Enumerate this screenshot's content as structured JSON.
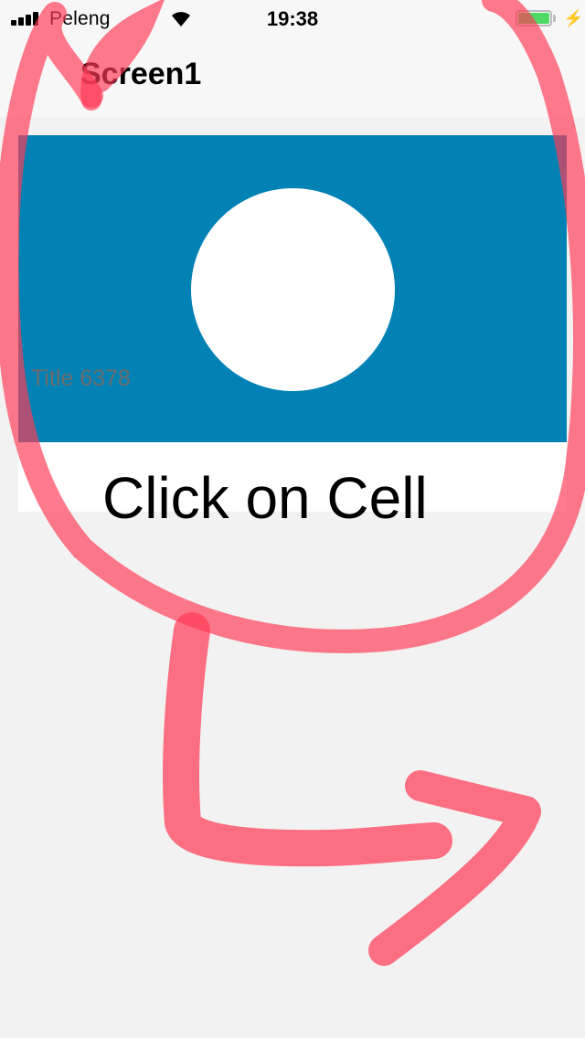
{
  "status_bar": {
    "carrier": "Peleng",
    "time": "19:38",
    "signal_icon": "signal-icon",
    "wifi_icon": "wifi-icon",
    "battery_icon": "battery-icon",
    "battery_level": 1.0,
    "battery_color": "#4cd964",
    "charging_icon": "bolt-icon",
    "charging_glyph": "⚡"
  },
  "nav": {
    "title": "Screen1"
  },
  "card": {
    "caption": "Title 6378",
    "banner_color": "#0282b4",
    "circle_color": "#ffffff"
  },
  "instruction": {
    "text": "Click on Cell"
  },
  "annotation": {
    "color": "#ff3b57",
    "circle_icon": "red-marker-circle-icon",
    "arrow_icon": "red-marker-arrow-icon"
  }
}
